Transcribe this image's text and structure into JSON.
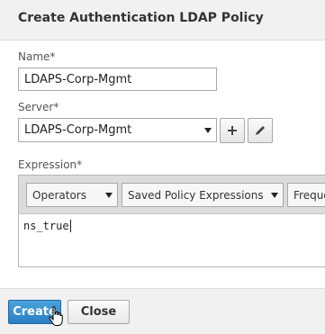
{
  "dialog": {
    "title": "Create Authentication LDAP Policy"
  },
  "form": {
    "name": {
      "label": "Name*",
      "value": "LDAPS-Corp-Mgmt"
    },
    "server": {
      "label": "Server*",
      "selected": "LDAPS-Corp-Mgmt",
      "add_icon": "plus-icon",
      "edit_icon": "pencil-icon"
    },
    "expression": {
      "label": "Expression*",
      "toolbar": {
        "operators": "Operators",
        "saved_policy_expressions": "Saved Policy Expressions",
        "frequently_used": "Freque"
      },
      "value": "ns_true"
    }
  },
  "footer": {
    "create_label": "Create",
    "close_label": "Close"
  },
  "colors": {
    "primary_button": "#2a7fc0",
    "header_bg": "#f1f1f1"
  }
}
